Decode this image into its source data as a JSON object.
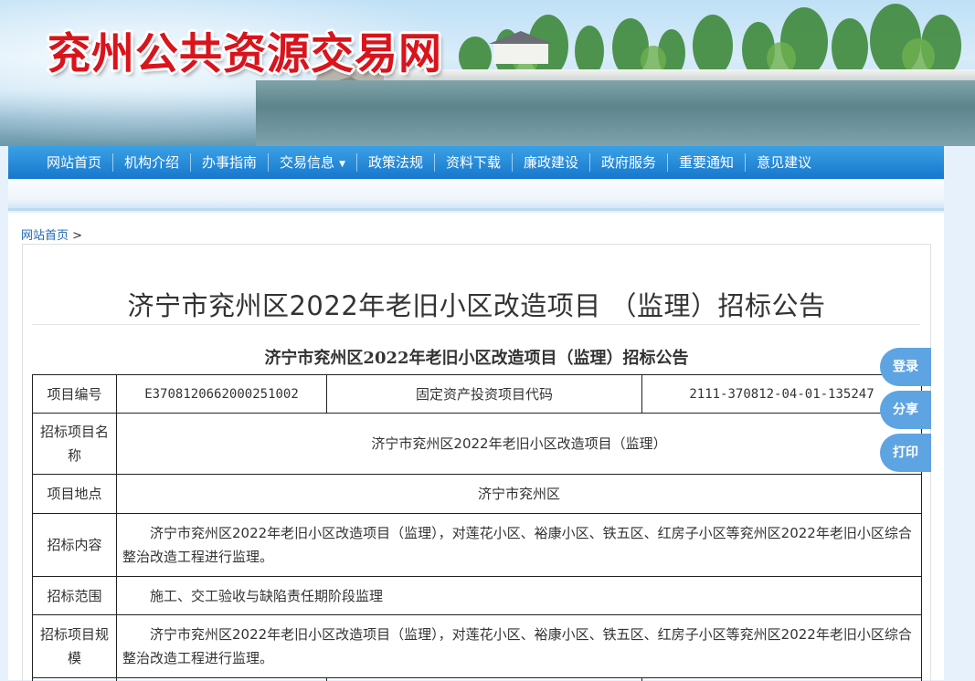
{
  "site": {
    "title": "兖州公共资源交易网"
  },
  "nav": {
    "items": [
      {
        "label": "网站首页"
      },
      {
        "label": "机构介绍"
      },
      {
        "label": "办事指南"
      },
      {
        "label": "交易信息",
        "dropdown": true
      },
      {
        "label": "政策法规"
      },
      {
        "label": "资料下载"
      },
      {
        "label": "廉政建设"
      },
      {
        "label": "政府服务"
      },
      {
        "label": "重要通知"
      },
      {
        "label": "意见建议"
      }
    ]
  },
  "breadcrumb": {
    "home": "网站首页",
    "separator": ">"
  },
  "article": {
    "title": "济宁市兖州区2022年老旧小区改造项目 （监理）招标公告",
    "doc_title": "济宁市兖州区2022年老旧小区改造项目（监理）招标公告",
    "table": {
      "project_no_label": "项目编号",
      "project_no": "E3708120662000251002",
      "invest_code_label": "固定资产投资项目代码",
      "invest_code": "2111-370812-04-01-135247",
      "name_label": "招标项目名称",
      "name": "济宁市兖州区2022年老旧小区改造项目（监理）",
      "location_label": "项目地点",
      "location": "济宁市兖州区",
      "content_label": "招标内容",
      "content": "济宁市兖州区2022年老旧小区改造项目（监理），对莲花小区、裕康小区、铁五区、红房子小区等兖州区2022年老旧小区综合整治改造工程进行监理。",
      "scope_label": "招标范围",
      "scope": "施工、交工验收与缺陷责任期阶段监理",
      "scale_label": "招标项目规模",
      "scale": "济宁市兖州区2022年老旧小区改造项目（监理），对莲花小区、裕康小区、铁五区、红房子小区等兖州区2022年老旧小区综合整治改造工程进行监理。"
    }
  },
  "side_buttons": {
    "login": "登录",
    "share": "分享",
    "print": "打印"
  },
  "colors": {
    "title_red": "#d8141d",
    "nav_blue": "#1777cd",
    "side_button": "#5ea4e2",
    "link": "#2166b4"
  }
}
